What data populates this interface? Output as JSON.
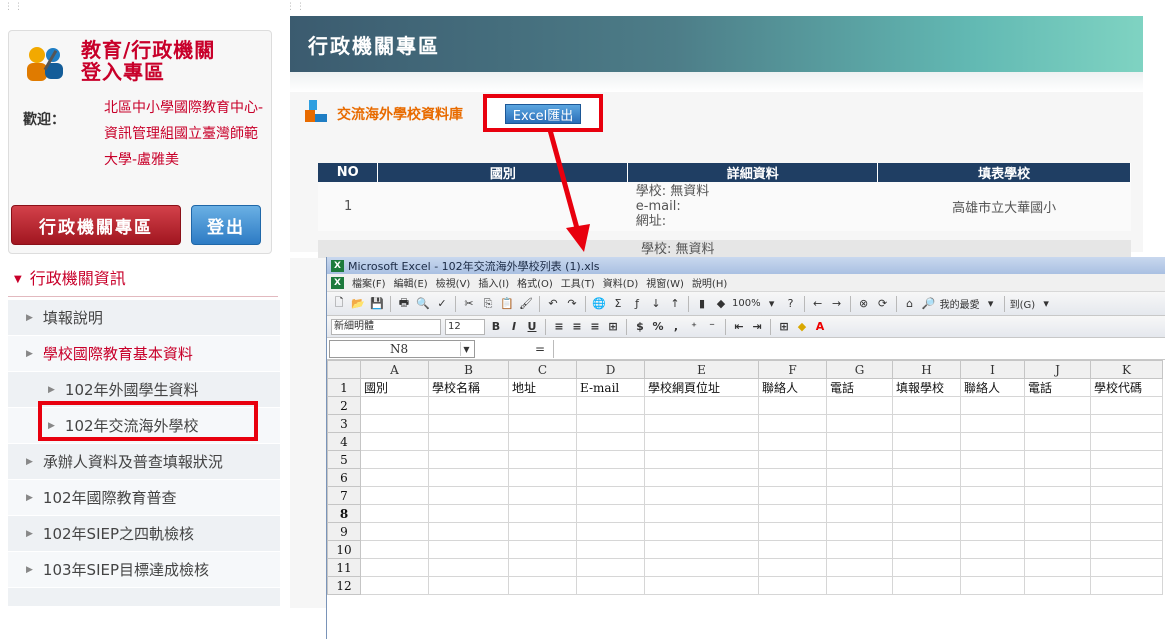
{
  "sidebar": {
    "login_title": [
      "教育/行政機關",
      "登入專區"
    ],
    "welcome_label": "歡迎：",
    "welcome_user": "北區中小學國際教育中心-資訊管理組國立臺灣師範大學-盧雅美",
    "admin_button": "行政機關專區",
    "logout_button": "登出",
    "section_title": "行政機關資訊",
    "menu": [
      {
        "label": "填報說明"
      },
      {
        "label": "學校國際教育基本資料"
      },
      {
        "label": "102年外國學生資料"
      },
      {
        "label": "102年交流海外學校"
      },
      {
        "label": "承辦人資料及普查填報狀況"
      },
      {
        "label": "102年國際教育普查"
      },
      {
        "label": "102年SIEP之四軌檢核"
      },
      {
        "label": "103年SIEP目標達成檢核"
      }
    ]
  },
  "main": {
    "header_title": "行政機關專區",
    "page_title": "交流海外學校資料庫",
    "excel_button": "Excel匯出",
    "table": {
      "headers": [
        "NO",
        "國別",
        "詳細資料",
        "填表學校"
      ],
      "rows": [
        {
          "no": "1",
          "country": "",
          "detail": [
            "學校: 無資料",
            "e-mail:",
            "網址:"
          ],
          "school": "高雄市立大華國小"
        }
      ],
      "row2_detail": "學校: 無資料"
    }
  },
  "excel": {
    "title": "Microsoft Excel - 102年交流海外學校列表 (1).xls",
    "menus": [
      "檔案(F)",
      "編輯(E)",
      "檢視(V)",
      "插入(I)",
      "格式(O)",
      "工具(T)",
      "資料(D)",
      "視窗(W)",
      "說明(H)"
    ],
    "zoom": "100%",
    "favorites": "我的最愛",
    "goto": "到(G)",
    "font_name": "新細明體",
    "font_size": "12",
    "name_box": "N8",
    "fx_label": "=",
    "columns": [
      "A",
      "B",
      "C",
      "D",
      "E",
      "F",
      "G",
      "H",
      "I",
      "J",
      "K"
    ],
    "row1": [
      "國別",
      "學校名稱",
      "地址",
      "E-mail",
      "學校網頁位址",
      "聯絡人",
      "電話",
      "填報學校",
      "聯絡人",
      "電話",
      "學校代碼"
    ],
    "row_numbers": [
      "1",
      "2",
      "3",
      "4",
      "5",
      "6",
      "7",
      "8",
      "9",
      "10",
      "11",
      "12"
    ],
    "selected_row": "8"
  },
  "colors": {
    "brand_red": "#c8002a",
    "highlight_red": "#e8000e",
    "header_navy": "#1f3e63",
    "accent_orange": "#e86b00"
  }
}
